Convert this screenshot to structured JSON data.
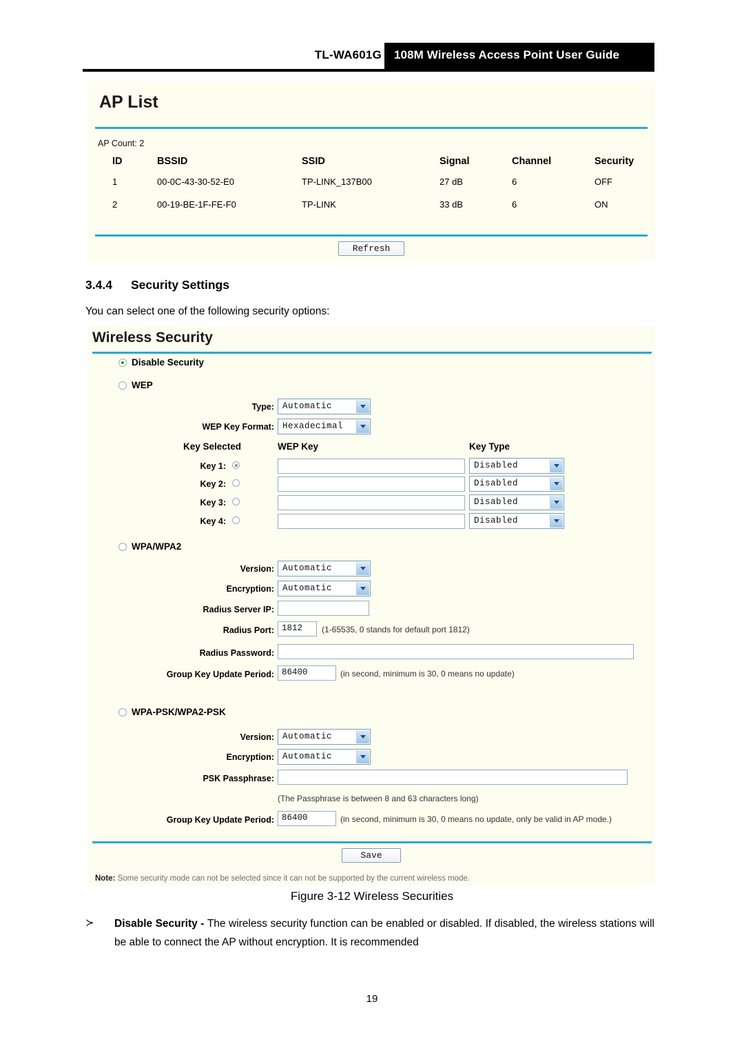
{
  "header": {
    "model": "TL-WA601G",
    "guide_title": "108M Wireless Access Point User Guide"
  },
  "ap_list": {
    "panel_title": "AP List",
    "count_label": "AP Count: 2",
    "columns": [
      "ID",
      "BSSID",
      "SSID",
      "Signal",
      "Channel",
      "Security"
    ],
    "rows": [
      {
        "id": "1",
        "bssid": "00-0C-43-30-52-E0",
        "ssid": "TP-LINK_137B00",
        "signal": "27 dB",
        "channel": "6",
        "security": "OFF"
      },
      {
        "id": "2",
        "bssid": "00-19-BE-1F-FE-F0",
        "ssid": "TP-LINK",
        "signal": "33 dB",
        "channel": "6",
        "security": "ON"
      }
    ],
    "refresh_label": "Refresh"
  },
  "section": {
    "number": "3.4.4",
    "title": "Security Settings",
    "intro": "You can select one of the following security options:"
  },
  "wireless_security": {
    "panel_title": "Wireless Security",
    "modes": {
      "disable": "Disable Security",
      "wep": "WEP",
      "wpa": "WPA/WPA2",
      "wpapsk": "WPA-PSK/WPA2-PSK"
    },
    "selected_mode": "disable",
    "wep": {
      "type_label": "Type:",
      "type_value": "Automatic",
      "key_format_label": "WEP Key Format:",
      "key_format_value": "Hexadecimal",
      "col_key_selected": "Key Selected",
      "col_wep_key": "WEP Key",
      "col_key_type": "Key Type",
      "keys": [
        {
          "label": "Key 1:",
          "selected": true,
          "value": "",
          "type": "Disabled"
        },
        {
          "label": "Key 2:",
          "selected": false,
          "value": "",
          "type": "Disabled"
        },
        {
          "label": "Key 3:",
          "selected": false,
          "value": "",
          "type": "Disabled"
        },
        {
          "label": "Key 4:",
          "selected": false,
          "value": "",
          "type": "Disabled"
        }
      ]
    },
    "wpa": {
      "version_label": "Version:",
      "version_value": "Automatic",
      "encryption_label": "Encryption:",
      "encryption_value": "Automatic",
      "radius_ip_label": "Radius Server IP:",
      "radius_ip_value": "",
      "radius_port_label": "Radius Port:",
      "radius_port_value": "1812",
      "radius_port_hint": "(1-65535, 0 stands for default port 1812)",
      "radius_password_label": "Radius Password:",
      "radius_password_value": "",
      "group_key_label": "Group Key Update Period:",
      "group_key_value": "86400",
      "group_key_hint": "(in second, minimum is 30, 0 means no update)"
    },
    "wpapsk": {
      "version_label": "Version:",
      "version_value": "Automatic",
      "encryption_label": "Encryption:",
      "encryption_value": "Automatic",
      "psk_label": "PSK Passphrase:",
      "psk_value": "",
      "psk_hint": "(The Passphrase is between 8 and 63 characters long)",
      "group_key_label": "Group Key Update Period:",
      "group_key_value": "86400",
      "group_key_hint": "(in second, minimum is 30, 0 means no update, only be valid in AP mode.)"
    },
    "save_label": "Save",
    "note_label": "Note:",
    "note_text": "Some security mode can not be selected since it can not be supported by the current wireless mode."
  },
  "figure_caption": "Figure 3-12 Wireless Securities",
  "bullet": {
    "arrow": "≻",
    "term": "Disable Security - ",
    "text": "The wireless security function can be enabled or disabled. If disabled, the wireless stations will be able to connect the AP without encryption. It is recommended"
  },
  "page_number": "19",
  "colors": {
    "panel_bg": "#FDFDF0",
    "rule_cyan": "#2BA9D1",
    "header_black": "#000000",
    "radio_on": "#1F9D22"
  }
}
